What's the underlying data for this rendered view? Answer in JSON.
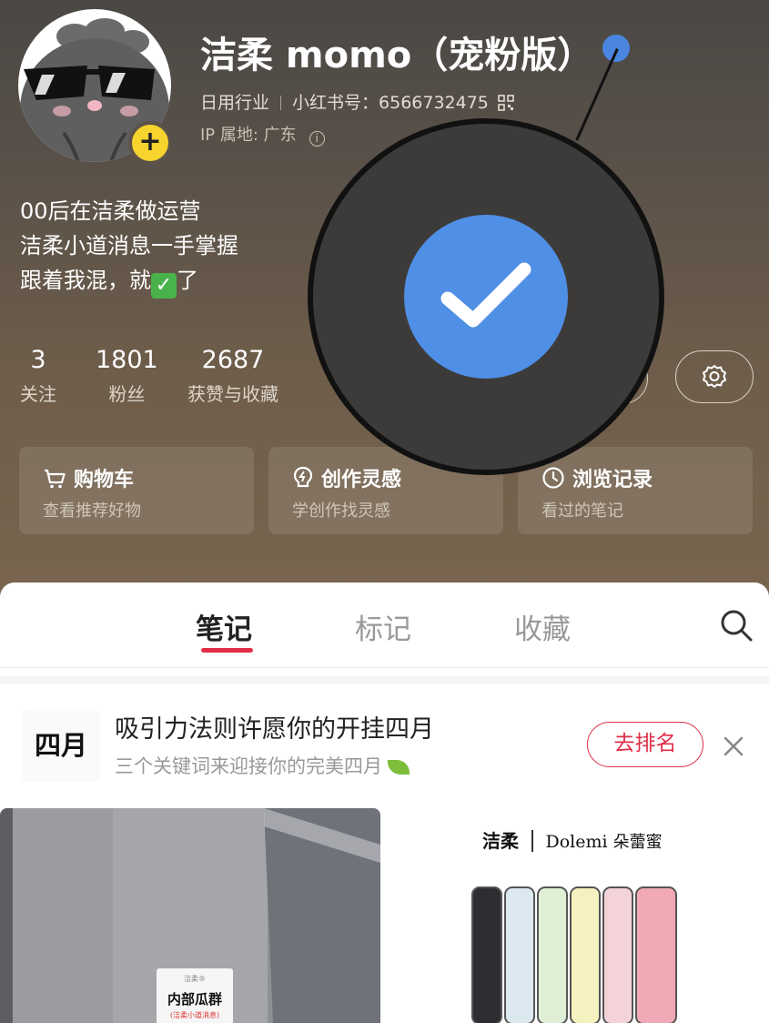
{
  "profile": {
    "name": "洁柔 momo（宠粉版）",
    "industry": "日用行业",
    "redbook_id": "小红书号：6566732475",
    "ip_location": "IP 属地: 广东",
    "bio": [
      "00后在洁柔做运营",
      "洁柔小道消息一手掌握",
      "跟着我混，就",
      "了"
    ],
    "verified_icon": "verified-check-icon"
  },
  "stats": [
    {
      "value": "3",
      "label": "关注"
    },
    {
      "value": "1801",
      "label": "粉丝"
    },
    {
      "value": "2687",
      "label": "获赞与收藏"
    }
  ],
  "cards": [
    {
      "title": "购物车",
      "sub": "查看推荐好物",
      "icon": "cart-icon"
    },
    {
      "title": "创作灵感",
      "sub": "学创作找灵感",
      "icon": "bulb-icon"
    },
    {
      "title": "浏览记录",
      "sub": "看过的笔记",
      "icon": "clock-icon"
    }
  ],
  "tabs": [
    {
      "label": "笔记",
      "active": true
    },
    {
      "label": "标记",
      "active": false
    },
    {
      "label": "收藏",
      "active": false
    }
  ],
  "banner": {
    "badge": "四月",
    "title": "吸引力法则许愿你的开挂四月",
    "subtitle": "三个关键词来迎接你的完美四月",
    "action": "去排名"
  },
  "feed": {
    "left_poster": {
      "top": "洁柔®",
      "title": "内部瓜群",
      "note": "(洁柔小道消息)"
    },
    "right_brand": {
      "brand1": "洁柔",
      "brand2": "Dolemi",
      "brand3": "朵蕾蜜"
    }
  },
  "colors": {
    "accent": "#e02e48",
    "verified": "#4f8fe6",
    "plus_badge": "#f6d32d"
  }
}
